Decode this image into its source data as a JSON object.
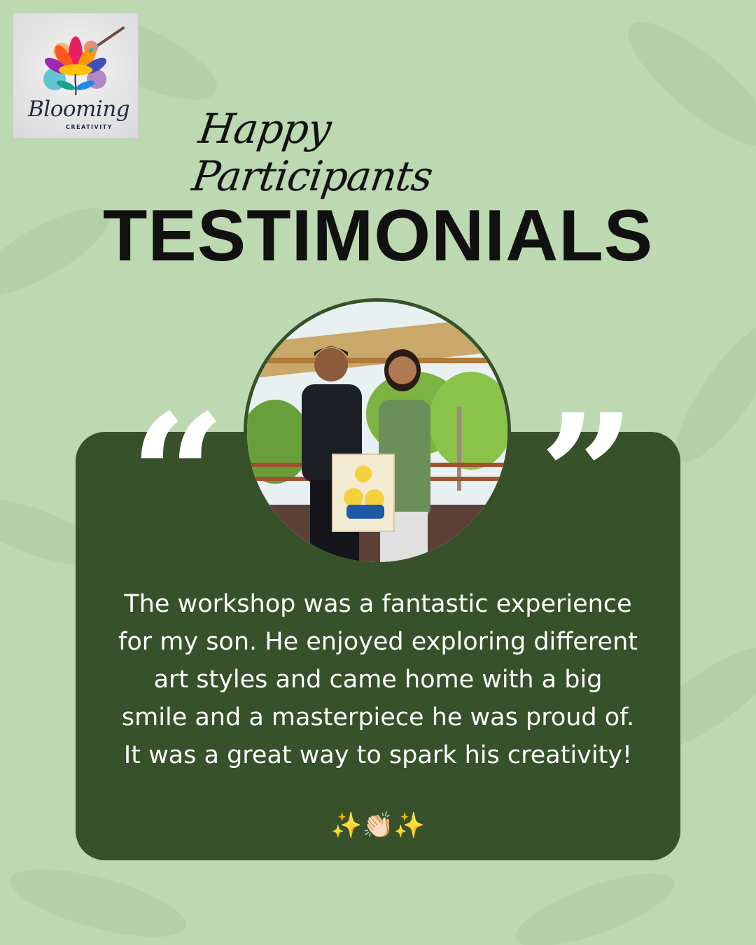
{
  "brand": {
    "name": "Blooming",
    "tagline": "CREATIVITY",
    "logo_icon": "lotus-paintbrush-icon"
  },
  "header": {
    "script_heading": "Happy Participants",
    "title": "TESTIMONIALS"
  },
  "testimonial": {
    "open_quote": "“",
    "close_quote": "”",
    "photo": "participant-photo",
    "text": "The workshop was a fantastic experience for my son. He enjoyed exploring different art styles and came home with a big smile and a masterpiece he was proud of. It was a great way to spark his creativity!",
    "emoji": "✨👏🏻✨"
  },
  "colors": {
    "background": "#bdd9b1",
    "card": "#37512a",
    "text_dark": "#111111",
    "text_light": "#ffffff"
  }
}
